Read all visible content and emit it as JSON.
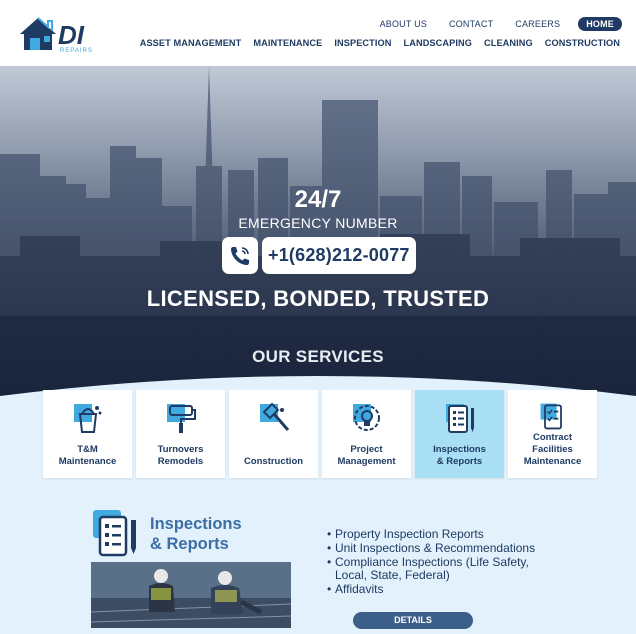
{
  "header": {
    "logo_text": "DI",
    "logo_sub": "REPAIRS",
    "top_nav": [
      "ABOUT US",
      "CONTACT",
      "CAREERS",
      "HOME"
    ],
    "main_nav": [
      "ASSET MANAGEMENT",
      "MAINTENANCE",
      "INSPECTION",
      "LANDSCAPING",
      "CLEANING",
      "CONSTRUCTION"
    ],
    "active_top": "HOME"
  },
  "hero": {
    "hours": "24/7",
    "emergency_label": "EMERGENCY NUMBER",
    "phone_icon": "phone-icon",
    "phone": "+1(628)212-0077",
    "tagline": "LICENSED, BONDED, TRUSTED",
    "services_heading": "OUR SERVICES"
  },
  "services": [
    {
      "label": "T&M\nMaintenance",
      "icon": "paint-bucket-icon",
      "active": false
    },
    {
      "label": "Turnovers\nRemodels",
      "icon": "paint-roller-icon",
      "active": false
    },
    {
      "label": "Construction",
      "icon": "hammer-icon",
      "active": false
    },
    {
      "label": "Project\nManagement",
      "icon": "lightbulb-gear-icon",
      "active": false
    },
    {
      "label": "Inspections\n& Reports",
      "icon": "clipboard-pen-icon",
      "active": true
    },
    {
      "label": "Contract\nFacilities\nMaintenance",
      "icon": "checklist-icon",
      "active": false
    }
  ],
  "detail": {
    "title_line1": "Inspections",
    "title_line2": "& Reports",
    "icon": "clipboard-pen-icon",
    "bullets": [
      "Property Inspection Reports",
      "Unit Inspections & Recommendations",
      "Compliance Inspections (Life Safety,\nLocal, State, Federal)",
      "Affidavits"
    ],
    "button": "DETAILS"
  },
  "colors": {
    "brand_navy": "#1f3b63",
    "accent_blue": "#3c6ea3",
    "active_card": "#a9dff5",
    "light_bg": "#e2f1fb"
  }
}
